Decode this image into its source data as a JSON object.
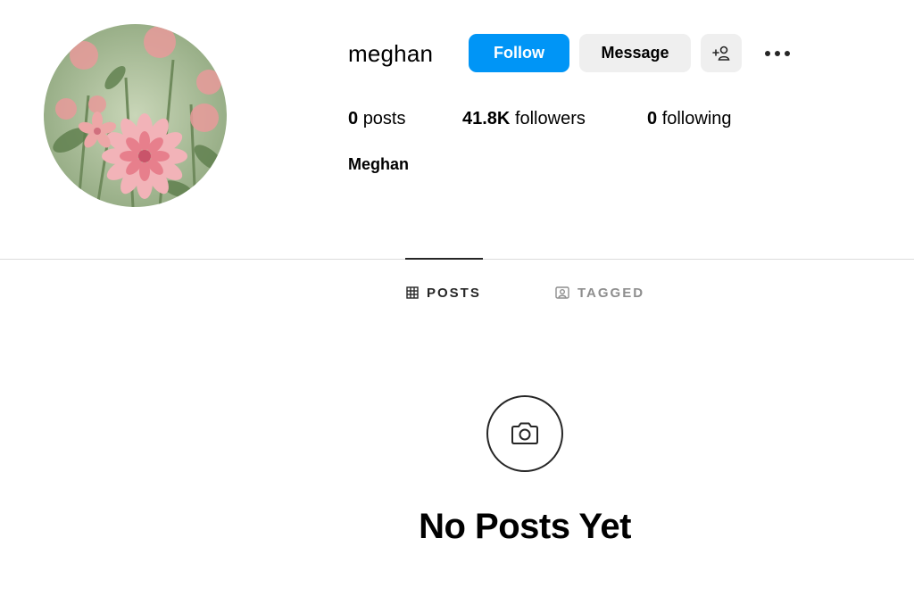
{
  "profile": {
    "username": "meghan",
    "full_name": "Meghan",
    "avatar_icon": "flower-photo"
  },
  "actions": {
    "follow_label": "Follow",
    "message_label": "Message",
    "add_user_icon": "add-user-icon",
    "more_icon": "more-options-icon"
  },
  "stats": {
    "posts_count": "0",
    "posts_label": "posts",
    "followers_count": "41.8K",
    "followers_label": "followers",
    "following_count": "0",
    "following_label": "following"
  },
  "tabs": [
    {
      "label": "POSTS",
      "icon": "grid-icon",
      "active": true
    },
    {
      "label": "TAGGED",
      "icon": "tagged-icon",
      "active": false
    }
  ],
  "empty_state": {
    "icon": "camera-icon",
    "title": "No Posts Yet"
  },
  "colors": {
    "follow_button": "#0095f6",
    "secondary_button": "#efefef",
    "divider": "#dbdbdb",
    "inactive_tab": "#8e8e8e"
  }
}
